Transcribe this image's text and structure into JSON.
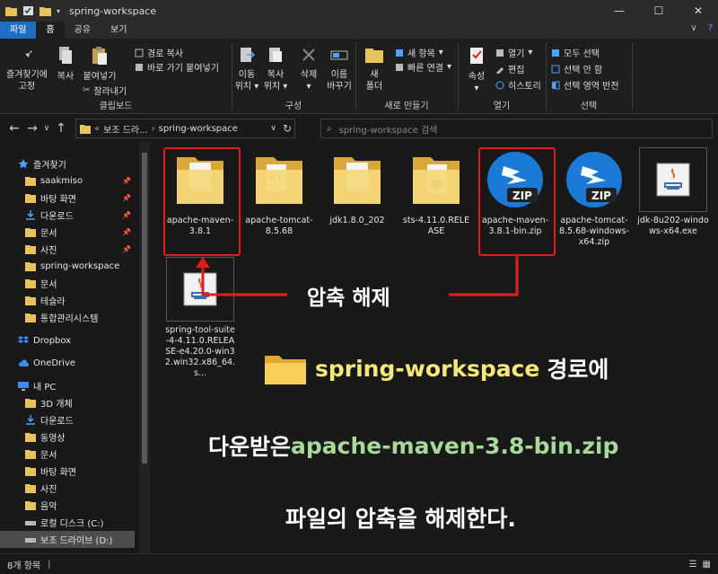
{
  "window": {
    "title": "spring-workspace"
  },
  "tabs": [
    "파일",
    "홈",
    "공유",
    "보기"
  ],
  "ribbon": {
    "clipboard": {
      "pin": [
        "즐겨찾기에",
        "고정"
      ],
      "copy": "복사",
      "paste": "붙여넣기",
      "copy_path": "경로 복사",
      "paste_shortcut": "바로 가기 붙여넣기",
      "cut": "잘라내기",
      "label": "클립보드"
    },
    "organize": {
      "move": [
        "이동",
        "위치"
      ],
      "copy_to": [
        "복사",
        "위치"
      ],
      "delete": "삭제",
      "rename": [
        "이름",
        "바꾸기"
      ],
      "label": "구성"
    },
    "new": {
      "folder": [
        "새",
        "폴더"
      ],
      "new_item": "새 항목",
      "easy_access": "빠른 연결",
      "label": "새로 만들기"
    },
    "open": {
      "properties": "속성",
      "open": "열기",
      "edit": "편집",
      "history": "히스토리",
      "label": "열기"
    },
    "select": {
      "select_all": "모두 선택",
      "select_none": "선택 안 함",
      "invert": "선택 영역 반전",
      "label": "선택"
    }
  },
  "address": {
    "crumbs": [
      "«",
      "보조 드라...",
      "›",
      "spring-workspace"
    ],
    "search_placeholder": "spring-workspace 검색"
  },
  "nav": [
    {
      "label": "즐겨찾기",
      "icon": "star-icon",
      "pinned": false
    },
    {
      "label": "saakmiso",
      "icon": "folder-icon",
      "pinned": true
    },
    {
      "label": "바탕 화면",
      "icon": "folder-icon",
      "pinned": true
    },
    {
      "label": "다운로드",
      "icon": "download-icon",
      "pinned": true
    },
    {
      "label": "문서",
      "icon": "folder-icon",
      "pinned": true
    },
    {
      "label": "사진",
      "icon": "folder-icon",
      "pinned": true
    },
    {
      "label": "spring-workspace",
      "icon": "folder-icon",
      "pinned": false
    },
    {
      "label": "문서",
      "icon": "folder-icon",
      "pinned": false
    },
    {
      "label": "테슬라",
      "icon": "folder-icon",
      "pinned": false
    },
    {
      "label": "통합관리시스템",
      "icon": "folder-icon",
      "pinned": false
    },
    {
      "label": "Dropbox",
      "icon": "dropbox-icon",
      "pinned": false
    },
    {
      "label": "OneDrive",
      "icon": "cloud-icon",
      "pinned": false
    },
    {
      "label": "내 PC",
      "icon": "pc-icon",
      "pinned": false
    },
    {
      "label": "3D 개체",
      "icon": "folder-icon",
      "pinned": false
    },
    {
      "label": "다운로드",
      "icon": "download-icon",
      "pinned": false
    },
    {
      "label": "동영상",
      "icon": "folder-icon",
      "pinned": false
    },
    {
      "label": "문서",
      "icon": "folder-icon",
      "pinned": false
    },
    {
      "label": "바탕 화면",
      "icon": "folder-icon",
      "pinned": false
    },
    {
      "label": "사진",
      "icon": "folder-icon",
      "pinned": false
    },
    {
      "label": "음악",
      "icon": "folder-icon",
      "pinned": false
    },
    {
      "label": "로컬 디스크 (C:)",
      "icon": "drive-icon",
      "pinned": false
    },
    {
      "label": "보조 드라이브 (D:)",
      "icon": "drive-icon",
      "pinned": false
    }
  ],
  "files": [
    {
      "name": "apache-maven-3.8.1",
      "type": "folder"
    },
    {
      "name": "apache-tomcat-8.5.68",
      "type": "folder"
    },
    {
      "name": "jdk1.8.0_202",
      "type": "folder"
    },
    {
      "name": "sts-4.11.0.RELEASE",
      "type": "folder"
    },
    {
      "name": "apache-maven-3.8.1-bin.zip",
      "type": "zip"
    },
    {
      "name": "apache-tomcat-8.5.68-windows-x64.zip",
      "type": "zip"
    },
    {
      "name": "jdk-8u202-windows-x64.exe",
      "type": "exe"
    },
    {
      "name": "spring-tool-suite-4-4.11.0.RELEASE-e4.20.0-win32.win32.x86_64.s...",
      "type": "exe"
    }
  ],
  "zip_badge": "ZIP",
  "status": {
    "count": "8개 항목"
  },
  "annotation": {
    "unzip": "압축 해제",
    "line1_highlight": "spring-workspace",
    "line1_rest": " 경로에",
    "line2_pre": "다운받은 ",
    "line2_highlight": "apache-maven-3.8-bin.zip",
    "line3": "파일의 압축을 해제한다."
  },
  "colors": {
    "red": "#e11c1c",
    "yellow": "#f5e87a",
    "green": "#a8d89a",
    "accent": "#1e6fc1"
  }
}
